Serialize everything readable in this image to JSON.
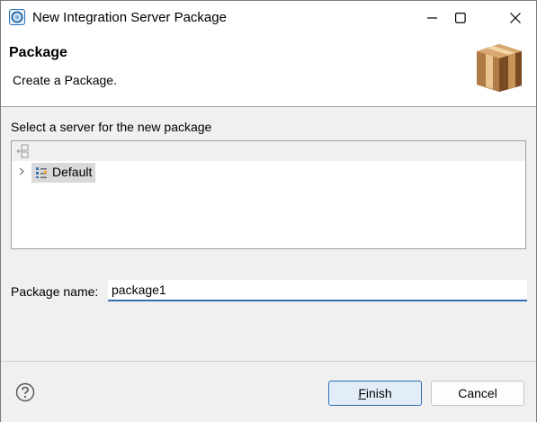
{
  "window": {
    "title": "New Integration Server Package"
  },
  "header": {
    "title": "Package",
    "description": "Create a Package."
  },
  "server_tree": {
    "label": "Select a server for the new package",
    "items": [
      {
        "label": "Default",
        "selected": true,
        "expanded": false
      }
    ]
  },
  "package_name": {
    "label": "Package name:",
    "value": "package1"
  },
  "buttons": {
    "finish_mnemonic": "F",
    "finish_rest": "inish",
    "cancel": "Cancel"
  },
  "icons": {
    "app": "integration-server-app-icon",
    "minimize": "minimize-icon",
    "maximize": "maximize-icon",
    "close": "close-icon",
    "package": "package-box-icon",
    "tree_toolbar": "collapse-tree-icon",
    "expand": "chevron-right-icon",
    "server": "server-icon",
    "help": "help-icon"
  },
  "colors": {
    "accent": "#2f6db5",
    "selection": "#d9d9d9",
    "background": "#f0f0f0",
    "box_brown": "#a8703a"
  }
}
